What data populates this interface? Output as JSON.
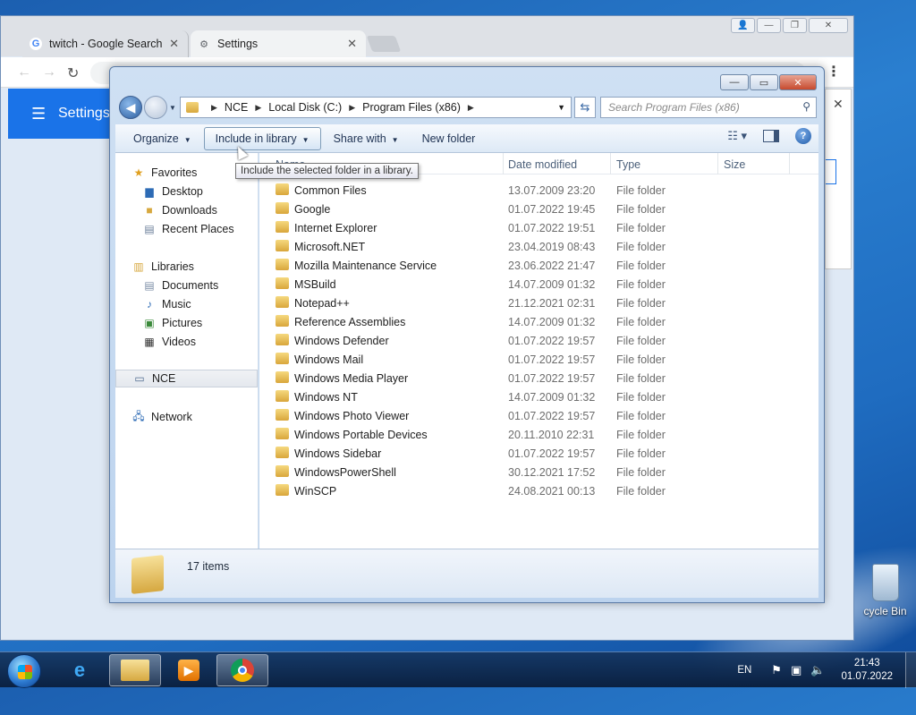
{
  "chrome": {
    "tabs": [
      {
        "label": "twitch - Google Search",
        "icon": "google-icon"
      },
      {
        "label": "Settings",
        "icon": "gear-icon"
      }
    ],
    "page_title": "Settings"
  },
  "explorer": {
    "breadcrumbs": [
      "NCE",
      "Local Disk (C:)",
      "Program Files (x86)"
    ],
    "search_placeholder": "Search Program Files (x86)",
    "commands": {
      "organize": "Organize",
      "include_in_library": "Include in library",
      "share_with": "Share with",
      "new_folder": "New folder"
    },
    "tooltip": "Include the selected folder in a library.",
    "nav": {
      "favorites": "Favorites",
      "desktop": "Desktop",
      "downloads": "Downloads",
      "recent_places": "Recent Places",
      "libraries": "Libraries",
      "documents": "Documents",
      "music": "Music",
      "pictures": "Pictures",
      "videos": "Videos",
      "computer": "NCE",
      "network": "Network"
    },
    "columns": {
      "name": "Name",
      "date_modified": "Date modified",
      "type": "Type",
      "size": "Size"
    },
    "rows": [
      {
        "name": "Common Files",
        "date": "13.07.2009 23:20",
        "type": "File folder"
      },
      {
        "name": "Google",
        "date": "01.07.2022 19:45",
        "type": "File folder"
      },
      {
        "name": "Internet Explorer",
        "date": "01.07.2022 19:51",
        "type": "File folder"
      },
      {
        "name": "Microsoft.NET",
        "date": "23.04.2019 08:43",
        "type": "File folder"
      },
      {
        "name": "Mozilla Maintenance Service",
        "date": "23.06.2022 21:47",
        "type": "File folder"
      },
      {
        "name": "MSBuild",
        "date": "14.07.2009 01:32",
        "type": "File folder"
      },
      {
        "name": "Notepad++",
        "date": "21.12.2021 02:31",
        "type": "File folder"
      },
      {
        "name": "Reference Assemblies",
        "date": "14.07.2009 01:32",
        "type": "File folder"
      },
      {
        "name": "Windows Defender",
        "date": "01.07.2022 19:57",
        "type": "File folder"
      },
      {
        "name": "Windows Mail",
        "date": "01.07.2022 19:57",
        "type": "File folder"
      },
      {
        "name": "Windows Media Player",
        "date": "01.07.2022 19:57",
        "type": "File folder"
      },
      {
        "name": "Windows NT",
        "date": "14.07.2009 01:32",
        "type": "File folder"
      },
      {
        "name": "Windows Photo Viewer",
        "date": "01.07.2022 19:57",
        "type": "File folder"
      },
      {
        "name": "Windows Portable Devices",
        "date": "20.11.2010 22:31",
        "type": "File folder"
      },
      {
        "name": "Windows Sidebar",
        "date": "01.07.2022 19:57",
        "type": "File folder"
      },
      {
        "name": "WindowsPowerShell",
        "date": "30.12.2021 17:52",
        "type": "File folder"
      },
      {
        "name": "WinSCP",
        "date": "24.08.2021 00:13",
        "type": "File folder"
      }
    ],
    "item_count": "17 items"
  },
  "desktop": {
    "recycle_bin": "cycle Bin"
  },
  "taskbar": {
    "lang": "EN",
    "time": "21:43",
    "date": "01.07.2022",
    "apps": [
      "internet-explorer-icon",
      "file-explorer-icon",
      "media-player-icon",
      "chrome-icon"
    ]
  },
  "colors": {
    "accent": "#1a73e8",
    "explorer_frame": "#bcd3ee",
    "taskbar": "#14325a"
  }
}
